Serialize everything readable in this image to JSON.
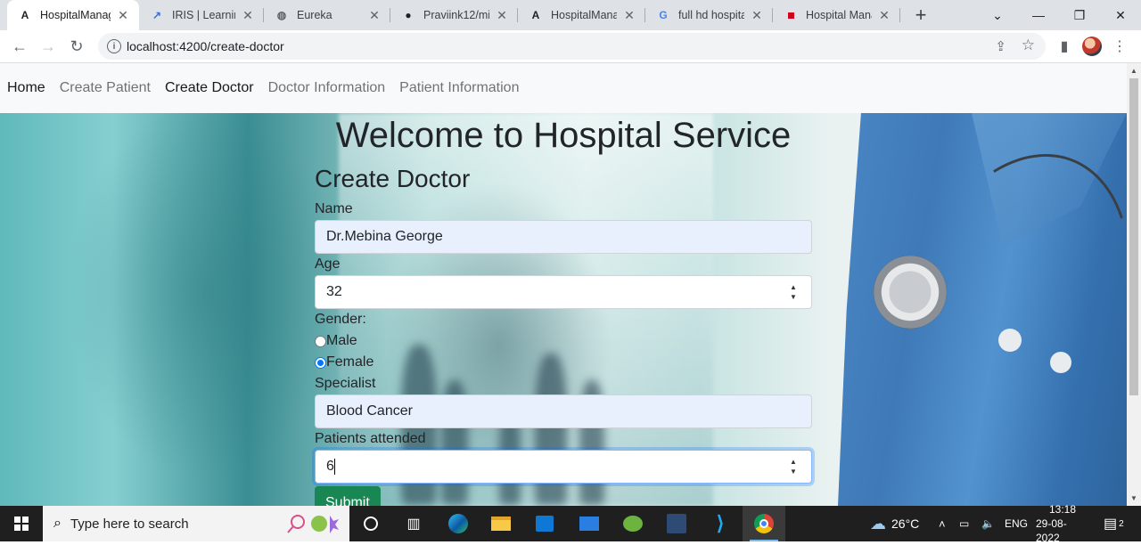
{
  "browser": {
    "tabs": [
      {
        "title": "HospitalManag",
        "icon": "angular-icon",
        "active": true
      },
      {
        "title": "IRIS | Learning",
        "icon": "iris-icon",
        "active": false
      },
      {
        "title": "Eureka",
        "icon": "globe-icon",
        "active": false
      },
      {
        "title": "Praviink12/mic",
        "icon": "github-icon",
        "active": false
      },
      {
        "title": "HospitalManag",
        "icon": "angular-icon",
        "active": false
      },
      {
        "title": "full hd hospital",
        "icon": "google-icon",
        "active": false
      },
      {
        "title": "Hospital Mana",
        "icon": "red-square-icon",
        "active": false
      }
    ],
    "url": "localhost:4200/create-doctor"
  },
  "navbar": {
    "items": [
      "Home",
      "Create Patient",
      "Create Doctor",
      "Doctor Information",
      "Patient Information"
    ]
  },
  "page": {
    "heading": "Welcome to Hospital Service",
    "form_title": "Create Doctor",
    "name_label": "Name",
    "name_value": "Dr.Mebina George",
    "age_label": "Age",
    "age_value": "32",
    "gender_label": "Gender:",
    "gender_options": [
      "Male",
      "Female"
    ],
    "gender_selected": "Female",
    "specialist_label": "Specialist",
    "specialist_value": "Blood Cancer",
    "patients_label": "Patients attended",
    "patients_value": "6",
    "submit_label": "Submit"
  },
  "taskbar": {
    "search_placeholder": "Type here to search",
    "weather": "26°C",
    "language": "ENG",
    "time": "13:18",
    "date": "29-08-2022",
    "notification_count": "2"
  }
}
